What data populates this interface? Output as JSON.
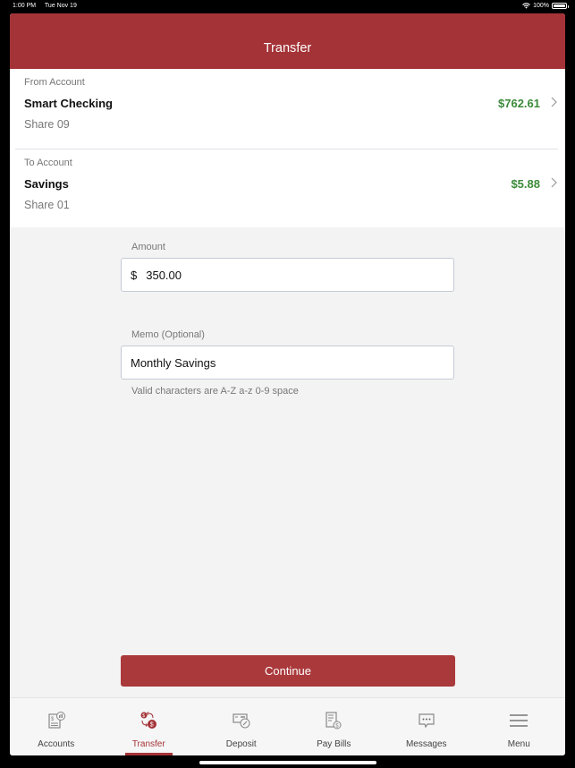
{
  "status_bar": {
    "time": "1:00 PM",
    "date": "Tue Nov 19",
    "battery": "100%"
  },
  "header": {
    "title": "Transfer"
  },
  "from_account": {
    "label": "From Account",
    "name": "Smart Checking",
    "share": "Share 09",
    "balance": "$762.61"
  },
  "to_account": {
    "label": "To Account",
    "name": "Savings",
    "share": "Share 01",
    "balance": "$5.88"
  },
  "amount": {
    "label": "Amount",
    "currency": "$",
    "value": "350.00"
  },
  "memo": {
    "label": "Memo (Optional)",
    "value": "Monthly Savings",
    "hint": "Valid characters are A-Z a-z 0-9 space"
  },
  "continue_label": "Continue",
  "colors": {
    "brand": "#a43337",
    "balance": "#3c8a3a"
  },
  "tabs": [
    {
      "label": "Accounts",
      "icon": "accounts-icon",
      "active": false
    },
    {
      "label": "Transfer",
      "icon": "transfer-icon",
      "active": true
    },
    {
      "label": "Deposit",
      "icon": "deposit-icon",
      "active": false
    },
    {
      "label": "Pay Bills",
      "icon": "pay-bills-icon",
      "active": false
    },
    {
      "label": "Messages",
      "icon": "messages-icon",
      "active": false
    },
    {
      "label": "Menu",
      "icon": "menu-icon",
      "active": false
    }
  ]
}
